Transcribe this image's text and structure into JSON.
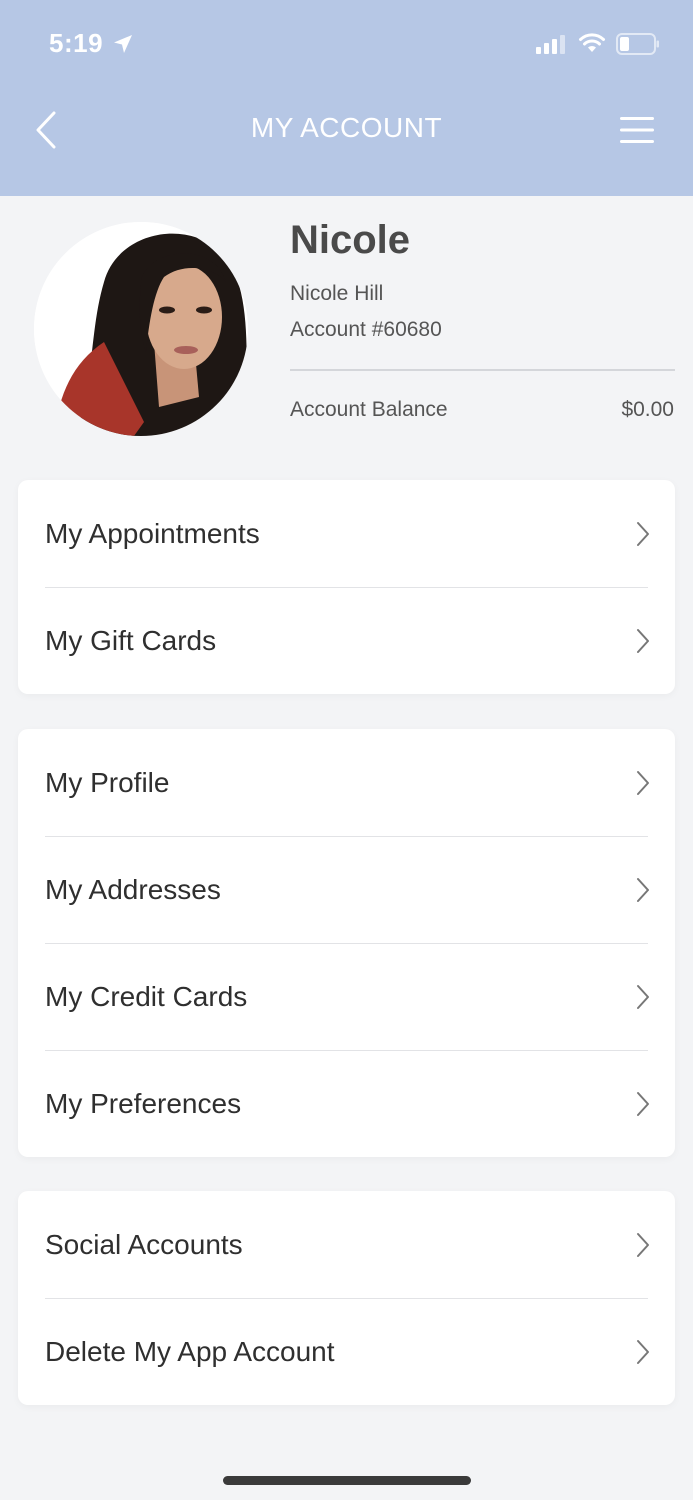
{
  "status_bar": {
    "time": "5:19"
  },
  "nav": {
    "title": "MY ACCOUNT"
  },
  "profile": {
    "nickname": "Nicole",
    "full_name": "Nicole Hill",
    "account_number": "Account #60680",
    "balance_label": "Account Balance",
    "balance_value": "$0.00"
  },
  "groups": [
    {
      "items": [
        "My Appointments",
        "My Gift Cards"
      ]
    },
    {
      "items": [
        "My Profile",
        "My Addresses",
        "My Credit Cards",
        "My Preferences"
      ]
    },
    {
      "items": [
        "Social Accounts",
        "Delete My App Account"
      ]
    }
  ],
  "colors": {
    "header": "#b6c7e5",
    "background": "#f3f4f6",
    "card": "#ffffff"
  },
  "icons": [
    "location-arrow-icon",
    "cellular-signal-icon",
    "wifi-icon",
    "battery-icon",
    "back-chevron-icon",
    "hamburger-menu-icon",
    "chevron-right-icon"
  ]
}
